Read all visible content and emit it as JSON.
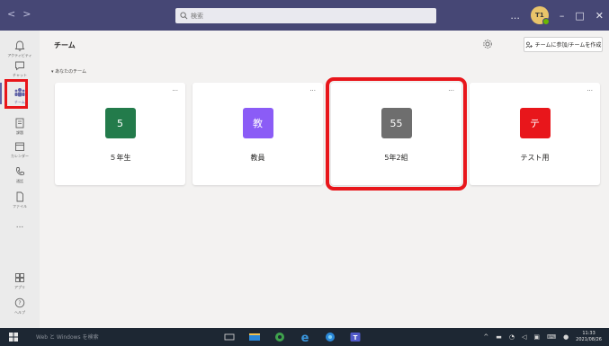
{
  "titlebar": {
    "back": "<",
    "forward": ">",
    "search_placeholder": "検索",
    "more": "...",
    "avatar_initials": "T1",
    "minimize": "–",
    "maximize": "□",
    "close": "✕"
  },
  "rail": {
    "items": [
      {
        "label": "アクティビティ",
        "icon": "bell-icon"
      },
      {
        "label": "チャット",
        "icon": "chat-icon"
      },
      {
        "label": "チーム",
        "icon": "teams-icon"
      },
      {
        "label": "課題",
        "icon": "assignments-icon"
      },
      {
        "label": "カレンダー",
        "icon": "calendar-icon"
      },
      {
        "label": "通話",
        "icon": "phone-icon"
      },
      {
        "label": "ファイル",
        "icon": "file-icon"
      },
      {
        "label": "...",
        "icon": "more-icon"
      },
      {
        "label": "アプリ",
        "icon": "apps-icon"
      },
      {
        "label": "ヘルプ",
        "icon": "help-icon"
      }
    ]
  },
  "header": {
    "title": "チーム",
    "join_button": "チームに参加/チームを作成"
  },
  "section": {
    "label": "▾ あなたのチーム"
  },
  "teams": [
    {
      "tile_text": "5",
      "name": "５年生",
      "color": "#237b4b"
    },
    {
      "tile_text": "教",
      "name": "教員",
      "color": "#8b5cf6"
    },
    {
      "tile_text": "55",
      "name": "5年2組",
      "color": "#6e6e6e"
    },
    {
      "tile_text": "テ",
      "name": "テスト用",
      "color": "#e8161b"
    }
  ],
  "card_more": "...",
  "taskbar": {
    "search_text": "Web と Windows を検索",
    "time": "11:33",
    "date": "2021/08/26"
  },
  "colors": {
    "titlebar": "#464775",
    "accent": "#6264a7",
    "highlight": "#e8161b"
  }
}
